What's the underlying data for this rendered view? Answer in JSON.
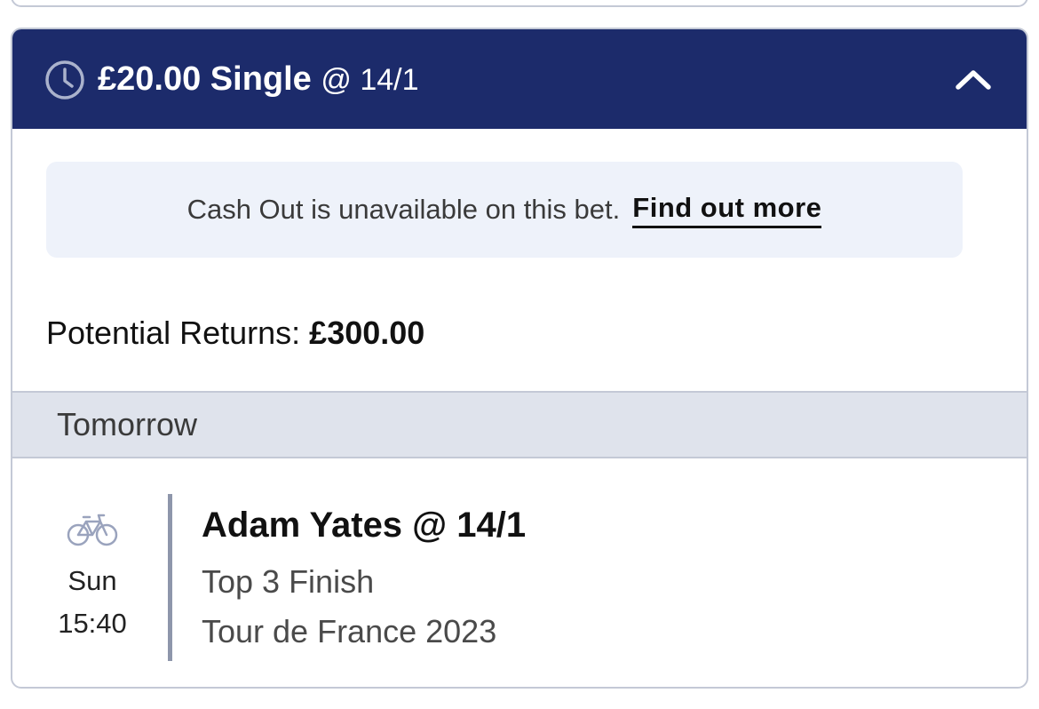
{
  "bet": {
    "stake_type": "£20.00 Single",
    "odds_suffix": "@ 14/1",
    "cashout_message": "Cash Out is unavailable on this bet.",
    "cashout_link": "Find out more",
    "returns_label": "Potential Returns:",
    "returns_value": "£300.00"
  },
  "day_group": {
    "label": "Tomorrow"
  },
  "selection": {
    "day": "Sun",
    "time": "15:40",
    "title": "Adam Yates @ 14/1",
    "market": "Top 3 Finish",
    "event": "Tour de France 2023",
    "sport_icon": "bicycle-icon"
  },
  "icons": {
    "header": "clock-icon",
    "collapse": "chevron-up-icon"
  },
  "colors": {
    "header_bg": "#1c2b6b",
    "banner_bg": "#eef2fa",
    "day_bar_bg": "#dfe3ec",
    "border": "#c4c9d6",
    "divider": "#8e96ab"
  }
}
